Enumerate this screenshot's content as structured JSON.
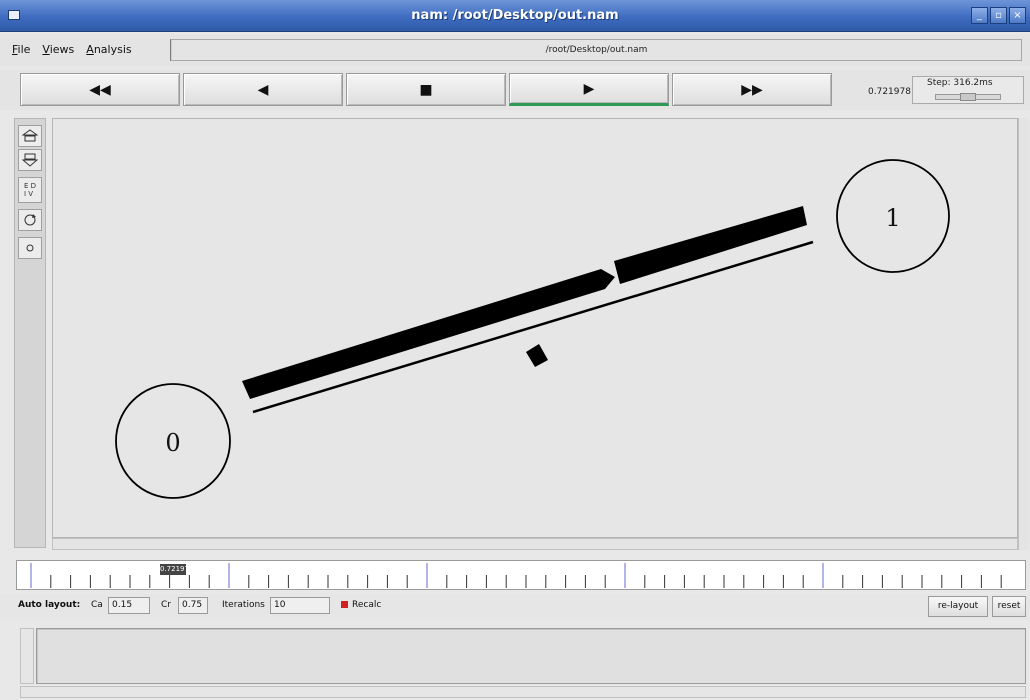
{
  "window": {
    "title": "nam: /root/Desktop/out.nam"
  },
  "menubar": {
    "items": [
      "File",
      "Views",
      "Analysis"
    ],
    "file_path": "/root/Desktop/out.nam"
  },
  "transport": {
    "rewind_label": "◀◀",
    "back_label": "◀",
    "stop_label": "■",
    "play_label": "▶",
    "forward_label": "▶▶",
    "time": "0.721978",
    "step_label": "Step: 316.2ms"
  },
  "nodes": [
    {
      "id": "0",
      "label": "0"
    },
    {
      "id": "1",
      "label": "1"
    }
  ],
  "timeline": {
    "marker_label": "0.721978"
  },
  "layout_controls": {
    "auto_layout_label": "Auto layout:",
    "ca_label": "Ca",
    "ca_value": "0.15",
    "cr_label": "Cr",
    "cr_value": "0.75",
    "iterations_label": "Iterations",
    "iterations_value": "10",
    "recalc_label": "Recalc",
    "relayout_label": "re-layout",
    "reset_label": "reset"
  },
  "colors": {
    "titlebar": "#3f6cc0",
    "play_indicator": "#2e9a55",
    "recalc_mark": "#d02020",
    "packet": "#000000"
  }
}
